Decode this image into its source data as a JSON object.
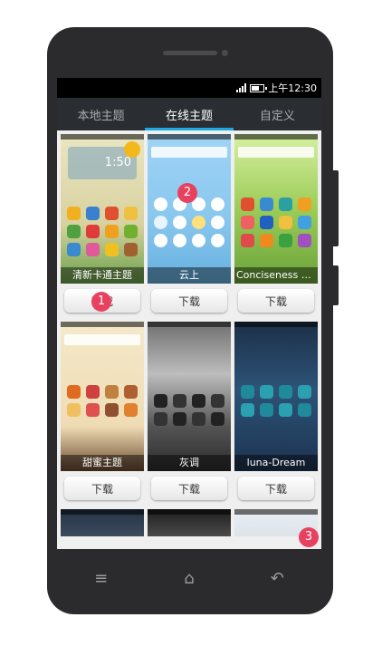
{
  "status_bar": {
    "time": "上午12:30"
  },
  "tabs": [
    {
      "label": "本地主题",
      "active": false
    },
    {
      "label": "在线主题",
      "active": true
    },
    {
      "label": "自定义",
      "active": false
    }
  ],
  "themes": [
    {
      "name": "清新卡通主题",
      "download_label": "下载"
    },
    {
      "name": "云上",
      "download_label": "下载"
    },
    {
      "name": "Conciseness and...",
      "download_label": "下载"
    },
    {
      "name": "甜蜜主题",
      "download_label": "下载"
    },
    {
      "name": "灰调",
      "download_label": "下载"
    },
    {
      "name": "luna-Dream",
      "download_label": "下载"
    }
  ],
  "widget": {
    "clock": "1:50"
  },
  "badges": [
    "1",
    "2",
    "3"
  ],
  "nav": {
    "menu_icon": "menu-icon",
    "home_icon": "home-icon",
    "back_icon": "back-icon"
  },
  "colors": {
    "accent": "#1ba9e2",
    "badge": "#e8415f",
    "phone_body": "#2b2b2d"
  }
}
